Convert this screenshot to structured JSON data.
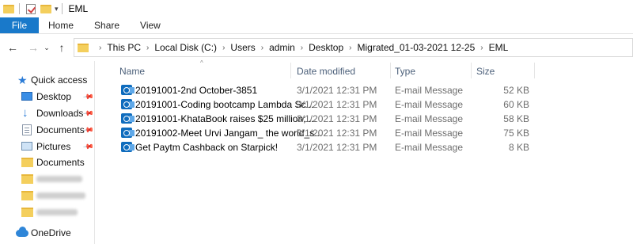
{
  "window": {
    "title": "EML"
  },
  "ribbon": {
    "tabs": [
      "File",
      "Home",
      "Share",
      "View"
    ]
  },
  "address": {
    "crumbs": [
      "This PC",
      "Local Disk (C:)",
      "Users",
      "admin",
      "Desktop",
      "Migrated_01-03-2021 12-25",
      "EML"
    ]
  },
  "nav": {
    "quick_access": "Quick access",
    "items": [
      "Desktop",
      "Downloads",
      "Documents",
      "Pictures",
      "Documents"
    ],
    "onedrive": "OneDrive"
  },
  "columns": {
    "name": "Name",
    "date": "Date modified",
    "type": "Type",
    "size": "Size"
  },
  "files": [
    {
      "name": "20191001-2nd October-3851",
      "date": "3/1/2021 12:31 PM",
      "type": "E-mail Message",
      "size": "52 KB"
    },
    {
      "name": "20191001-Coding bootcamp Lambda Sc...",
      "date": "3/1/2021 12:31 PM",
      "type": "E-mail Message",
      "size": "60 KB"
    },
    {
      "name": "20191001-KhataBook raises $25 million; ...",
      "date": "3/1/2021 12:31 PM",
      "type": "E-mail Message",
      "size": "58 KB"
    },
    {
      "name": "20191002-Meet Urvi Jangam_ the world_s...",
      "date": "3/1/2021 12:31 PM",
      "type": "E-mail Message",
      "size": "75 KB"
    },
    {
      "name": "Get Paytm Cashback on Starpick!",
      "date": "3/1/2021 12:31 PM",
      "type": "E-mail Message",
      "size": "8 KB"
    }
  ],
  "colors": {
    "accent": "#1979ca",
    "header_text": "#4c607a",
    "folder": "#f4cf5d"
  },
  "icons": {
    "file": "outlook-mail-icon",
    "quick_access": "star-icon",
    "desktop": "desktop-icon",
    "downloads": "download-arrow-icon",
    "documents": "documents-icon",
    "pictures": "pictures-icon",
    "folder": "folder-icon",
    "onedrive": "cloud-icon"
  }
}
